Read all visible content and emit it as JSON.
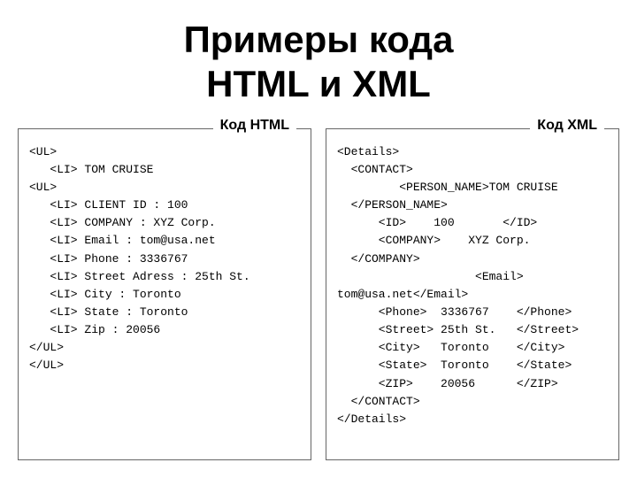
{
  "title": {
    "line1": "Примеры кода",
    "line2": "HTML и XML"
  },
  "html_panel": {
    "label": "Код HTML",
    "code": "<UL>\n   <LI> TOM CRUISE\n<UL>\n   <LI> CLIENT ID : 100\n   <LI> COMPANY : XYZ Corp.\n   <LI> Email : tom@usa.net\n   <LI> Phone : 3336767\n   <LI> Street Adress : 25th St.\n   <LI> City : Toronto\n   <LI> State : Toronto\n   <LI> Zip : 20056\n</UL>\n</UL>"
  },
  "xml_panel": {
    "label": "Код XML",
    "code": "<Details>\n  <CONTACT>\n         <PERSON_NAME>TOM CRUISE\n  </PERSON_NAME>\n      <ID>    100       </ID>\n      <COMPANY>    XYZ Corp.\n  </COMPANY>\n                    <Email>\ntom@usa.net</Email>\n      <Phone>  3336767    </Phone>\n      <Street> 25th St.   </Street>\n      <City>   Toronto    </City>\n      <State>  Toronto    </State>\n      <ZIP>    20056      </ZIP>\n  </CONTACT>\n</Details>"
  }
}
